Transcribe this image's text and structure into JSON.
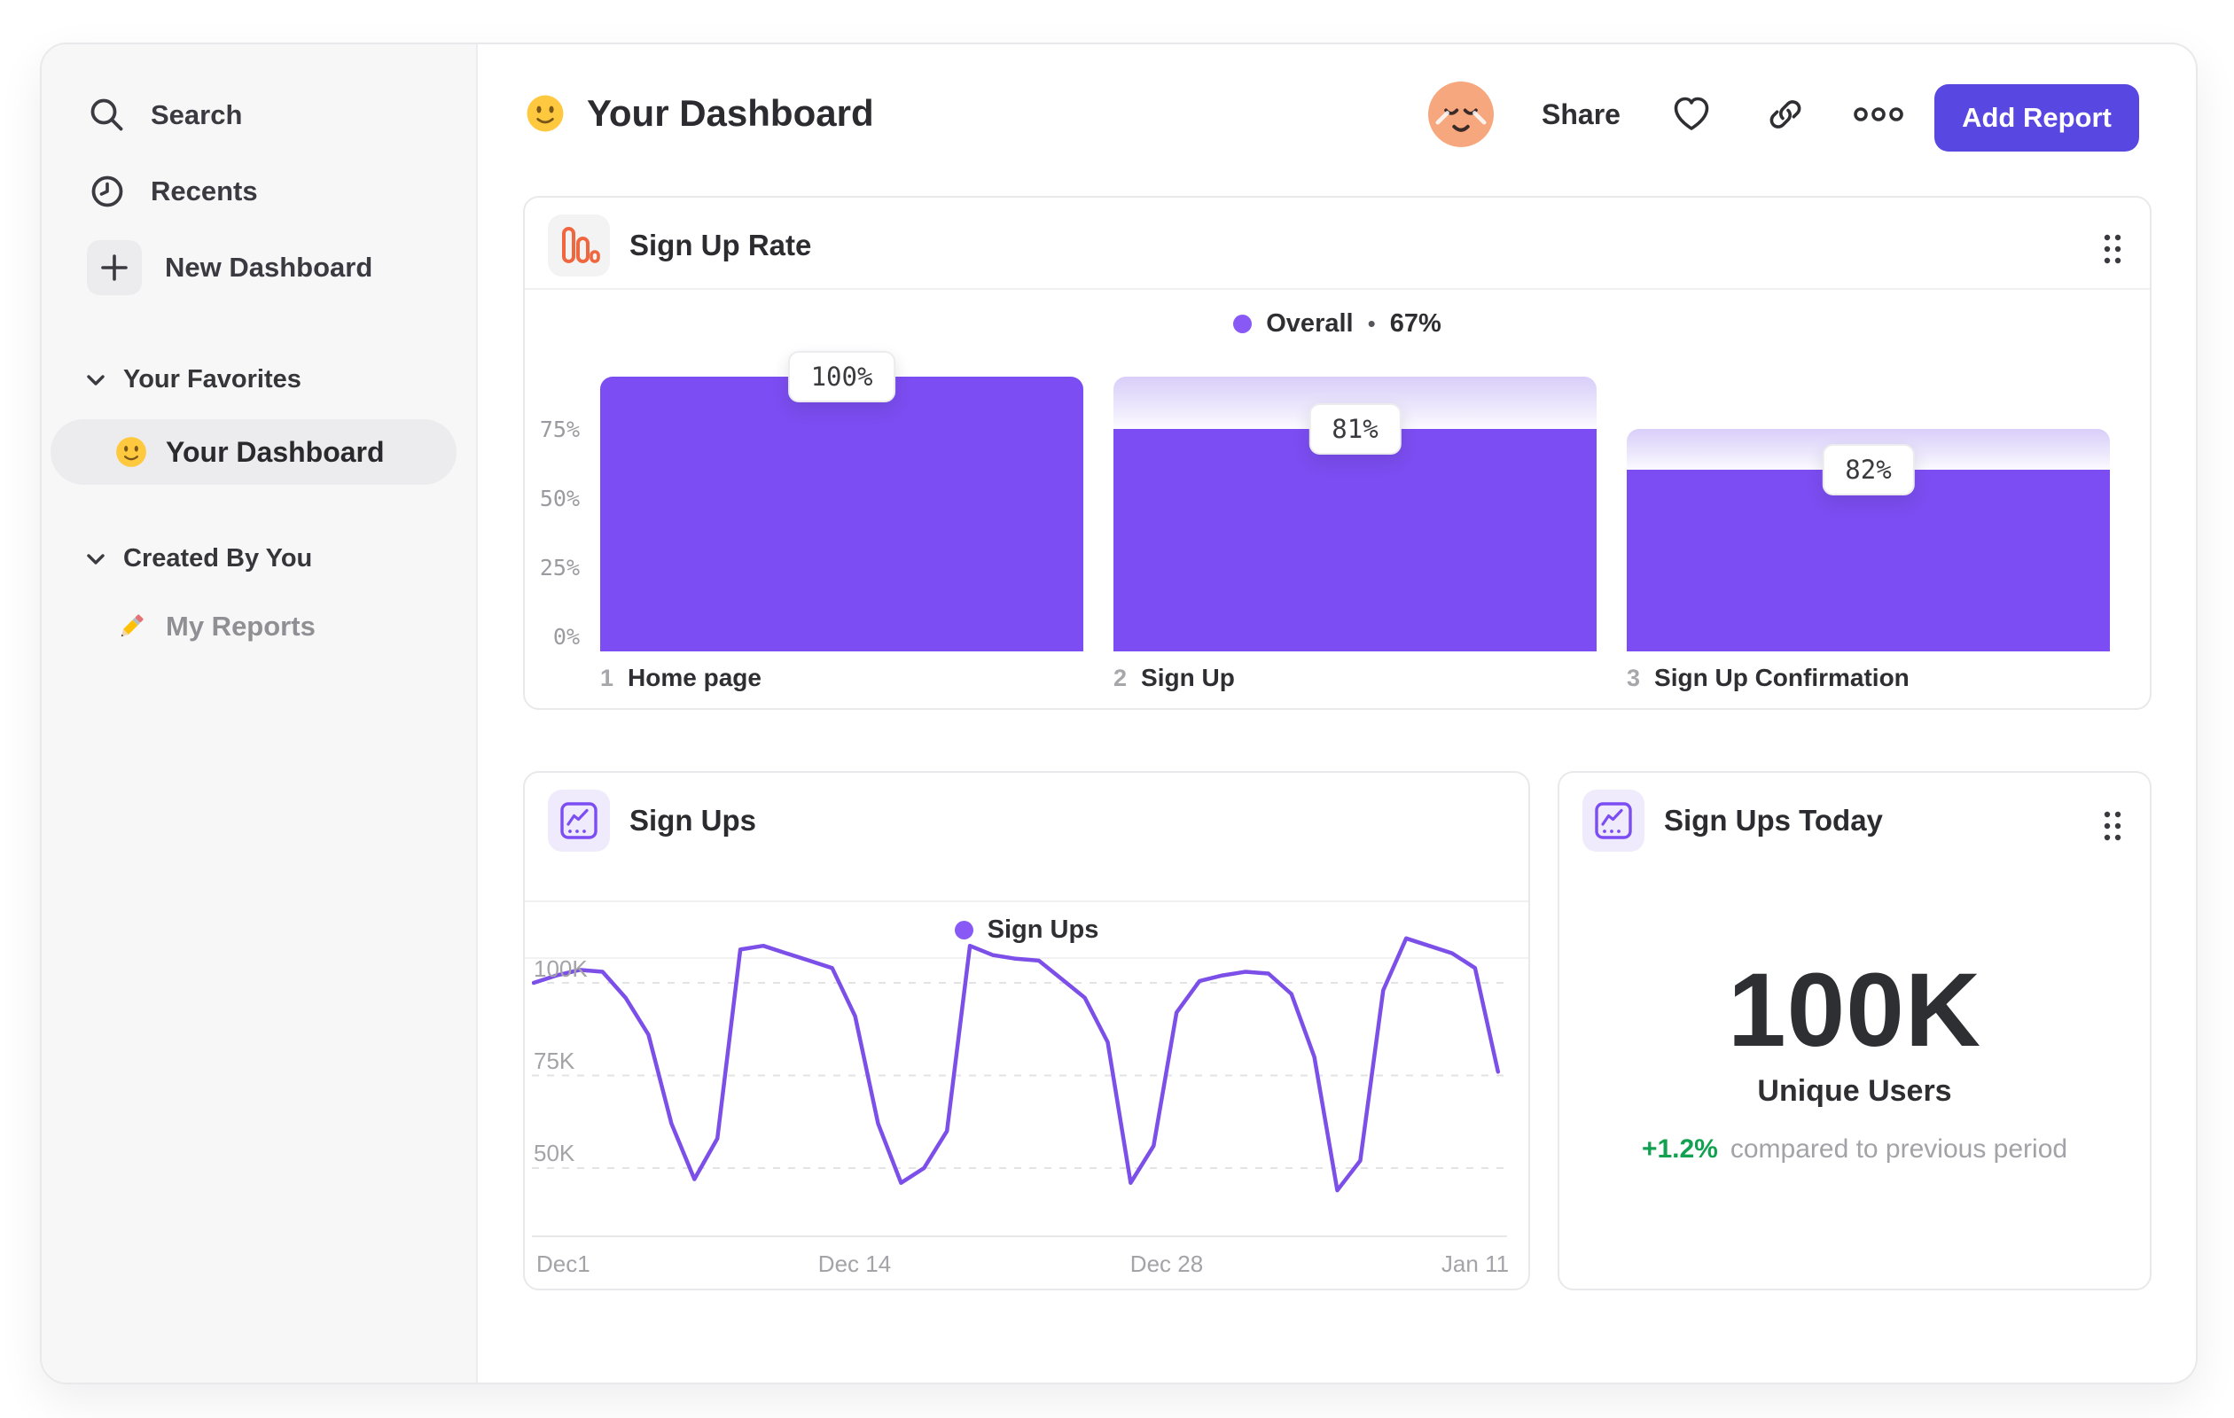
{
  "sidebar": {
    "search": "Search",
    "recents": "Recents",
    "new_dashboard": "New Dashboard",
    "favorites_header": "Your Favorites",
    "favorite_item": "Your Dashboard",
    "created_header": "Created By You",
    "created_item": "My Reports"
  },
  "header": {
    "title": "Your Dashboard",
    "share": "Share",
    "add_report": "Add Report"
  },
  "cards": {
    "funnel": {
      "title": "Sign Up Rate",
      "legend_name": "Overall",
      "legend_sep": "•",
      "legend_value": "67%"
    },
    "line": {
      "title": "Sign Ups",
      "legend_name": "Sign Ups"
    },
    "today": {
      "title": "Sign Ups Today",
      "value": "100K",
      "metric": "Unique Users",
      "delta": "+1.2%",
      "delta_desc": "compared to previous period"
    }
  },
  "colors": {
    "accent_purple": "#7C4DF2",
    "line_purple": "#7B4FE8",
    "legend_dot_purple": "#8959F5",
    "button_indigo": "#5847E1",
    "icon_orange": "#F0663F",
    "positive_green": "#12A150"
  },
  "chart_data": [
    {
      "type": "bar",
      "subtype": "funnel",
      "title": "Sign Up Rate",
      "legend": [
        {
          "name": "Overall",
          "value_pct": 67
        }
      ],
      "categories": [
        "Home page",
        "Sign Up",
        "Sign Up Confirmation"
      ],
      "ylabel_ticks": [
        "75%",
        "50%",
        "25%",
        "0%"
      ],
      "ylim": [
        0,
        100
      ],
      "grid": false,
      "legend_position": "top-center",
      "overall_conversion_pct": 67,
      "steps": [
        {
          "step": 1,
          "label": "Home page",
          "conversion_from_previous_pct": 100,
          "overall_pct": 100
        },
        {
          "step": 2,
          "label": "Sign Up",
          "conversion_from_previous_pct": 81,
          "overall_pct": 81
        },
        {
          "step": 3,
          "label": "Sign Up Confirmation",
          "conversion_from_previous_pct": 82,
          "overall_pct": 66
        }
      ]
    },
    {
      "type": "line",
      "title": "Sign Ups",
      "legend": [
        "Sign Ups"
      ],
      "legend_position": "top-center",
      "xlabel": "",
      "ylabel": "",
      "x_tick_labels": [
        "Dec1",
        "Dec 14",
        "Dec 28",
        "Jan 11"
      ],
      "x_tick_days": [
        0,
        13,
        27,
        41
      ],
      "y_tick_labels": [
        "100K",
        "75K",
        "50K"
      ],
      "y_ticks_k": [
        100,
        75,
        50
      ],
      "ylim_k": [
        40,
        115
      ],
      "grid": "dashed-horizontal",
      "unit": "sign ups (thousands)",
      "days": 43,
      "values_k": [
        100,
        102,
        103.5,
        103,
        96,
        86,
        62,
        47,
        58,
        109,
        110,
        108,
        106,
        104,
        91,
        62,
        46,
        50,
        60,
        110,
        107.5,
        106.5,
        106,
        101,
        96,
        84,
        46,
        56,
        92,
        100.5,
        102,
        103,
        102.5,
        97,
        80,
        44,
        52,
        98,
        112,
        110,
        108,
        104,
        76
      ]
    },
    {
      "type": "kpi",
      "title": "Sign Ups Today",
      "value": "100K",
      "metric": "Unique Users",
      "delta_pct": 1.2,
      "delta_text": "+1.2%",
      "comparison": "compared to previous period"
    }
  ]
}
